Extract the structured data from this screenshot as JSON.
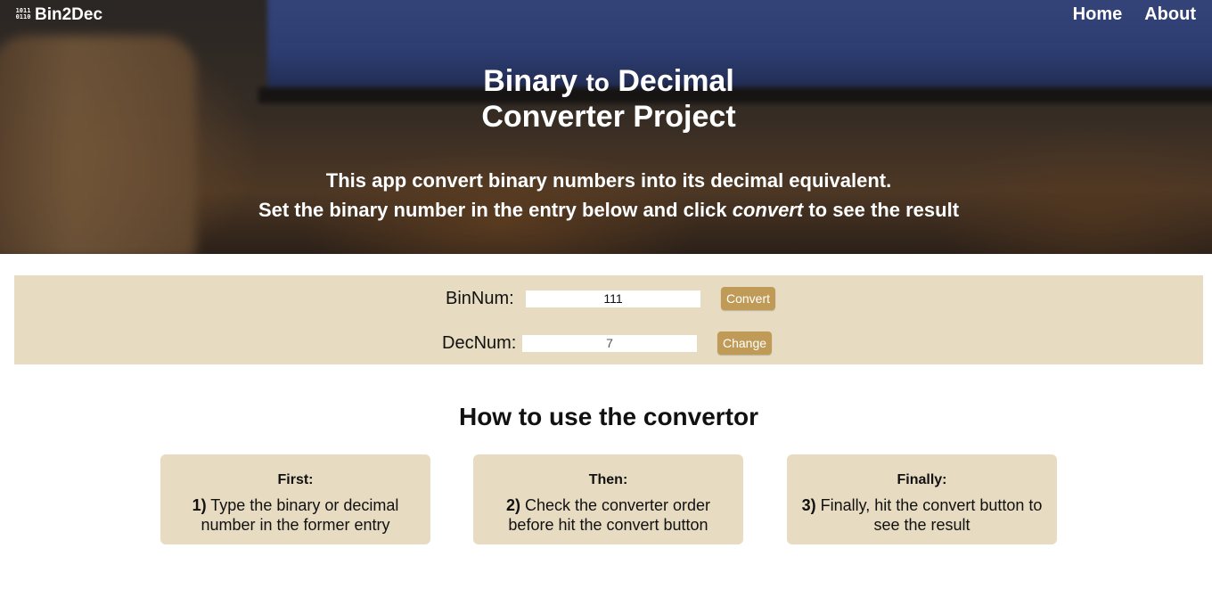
{
  "navbar": {
    "brand_icon_text": "1011\n0110",
    "brand_name": "Bin2Dec",
    "links": [
      "Home",
      "About"
    ]
  },
  "hero": {
    "title_part1": "Binary",
    "title_connector": "to",
    "title_part2": "Decimal",
    "title_line2": "Converter Project",
    "desc_line1": "This app convert binary numbers into its decimal equivalent.",
    "desc_line2_before": "Set the binary number in the entry below and click ",
    "desc_line2_emph": "convert",
    "desc_line2_after": " to see the result"
  },
  "converter": {
    "bin_label": "BinNum:",
    "bin_value": "111",
    "convert_button": "Convert",
    "dec_label": "DecNum:",
    "dec_value": "7",
    "change_button": "Change"
  },
  "howto": {
    "title": "How to use the convertor",
    "steps": [
      {
        "heading": "First:",
        "number": "1)",
        "text": " Type the binary or decimal number in the former entry"
      },
      {
        "heading": "Then:",
        "number": "2)",
        "text": " Check the converter order before hit the convert button"
      },
      {
        "heading": "Finally:",
        "number": "3)",
        "text": " Finally, hit the convert button to see the result"
      }
    ]
  },
  "colors": {
    "panel_bg": "#e7dbc1",
    "button_bg": "#c09a57"
  }
}
